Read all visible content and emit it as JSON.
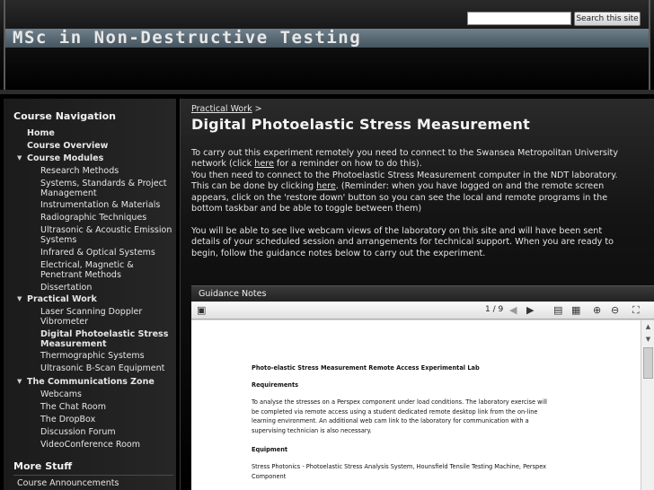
{
  "header": {
    "site_title": "MSc in Non-Destructive Testing",
    "search_placeholder": "",
    "search_button": "Search this site"
  },
  "sidebar": {
    "course_navigation": "Course Navigation",
    "home": "Home",
    "course_overview": "Course Overview",
    "course_modules": "Course Modules",
    "modules": [
      "Research Methods",
      "Systems, Standards & Project Management",
      "Instrumentation & Materials",
      "Radiographic Techniques",
      "Ultrasonic & Acoustic Emission Systems",
      "Infrared & Optical Systems",
      "Electrical, Magnetic & Penetrant Methods",
      "Dissertation"
    ],
    "practical_work": "Practical Work",
    "practicals": [
      "Laser Scanning Doppler Vibrometer",
      "Digital Photoelastic Stress Measurement",
      "Thermographic Systems",
      "Ultrasonic B-Scan Equipment"
    ],
    "communications_zone": "The Communications Zone",
    "comms": [
      "Webcams",
      "The Chat Room",
      "The DropBox",
      "Discussion Forum",
      "VideoConference Room"
    ],
    "more_stuff": "More Stuff",
    "more": [
      "Course Announcements"
    ]
  },
  "main": {
    "breadcrumb_link": "Practical Work",
    "breadcrumb_sep": ">",
    "title": "Digital Photoelastic Stress Measurement",
    "p1_a": "To carry out this experiment remotely you need to connect to the Swansea Metropolitan University",
    "p1_b_pre": "network (click ",
    "p1_b_link": "here",
    "p1_b_post": " for a reminder on how to do this).",
    "p1_c": "You then need to connect to the Photoelastic Stress Measurement computer in the NDT laboratory.",
    "p1_d_pre": "This can be done by clicking ",
    "p1_d_link": "here",
    "p1_d_post": ". (Reminder: when you have logged on and the remote screen",
    "p1_e": "appears, click on the 'restore down' button so you can see the local and remote programs in the",
    "p1_f": "bottom taskbar and be able to toggle between them)",
    "p2_a": "You will be able to see live webcam views of the laboratory on this site and will have been sent",
    "p2_b": "details of your scheduled session and arrangements for technical support. When you are ready to",
    "p2_c": "begin, follow the guidance notes below to carry out the experiment.",
    "guidance_title": "Guidance Notes"
  },
  "viewer": {
    "page_count": "1 / 9",
    "doc": {
      "heading": "Photo-elastic  Stress Measurement Remote Access Experimental Lab",
      "requirements": "Requirements",
      "req_1": "To analyse the stresses on a Perspex component under load conditions.  The laboratory exercise will",
      "req_2": "be completed via remote access using a student dedicated remote desktop link from the on-line",
      "req_3": "learning environment.  An additional web cam link to the laboratory for communication with a",
      "req_4": "supervising technician is also necessary.",
      "equipment": "Equipment",
      "eq_1": "Stress Photonics - Photoelastic Stress Analysis System, Hounsfield Tensile Testing Machine, Perspex",
      "eq_2": "Component"
    }
  }
}
